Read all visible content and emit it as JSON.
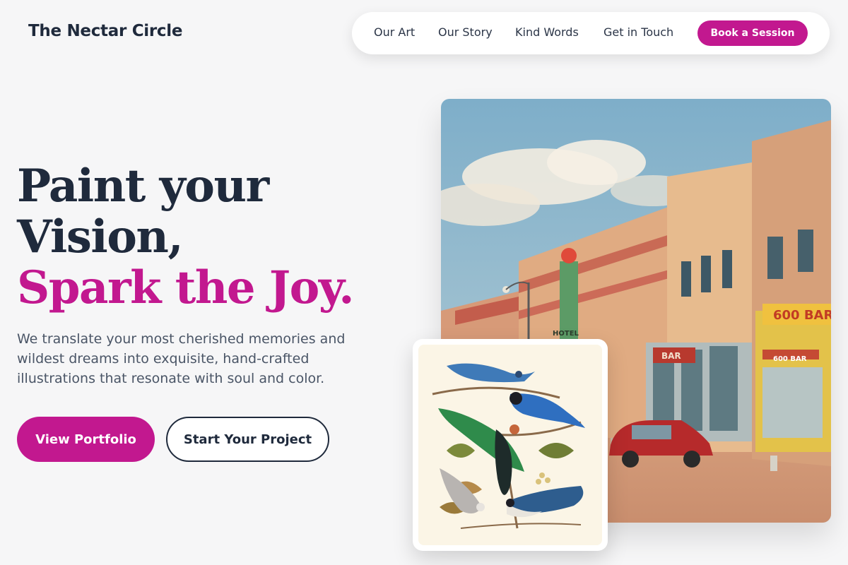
{
  "brand": {
    "name": "The Nectar Circle"
  },
  "nav": {
    "links": [
      "Our Art",
      "Our Story",
      "Kind Words",
      "Get in Touch"
    ],
    "cta_label": "Book a Session"
  },
  "hero": {
    "headline_line1": "Paint your",
    "headline_line2": "Vision,",
    "headline_accent": "Spark the Joy.",
    "lead": "We translate your most cherished memories and wildest dreams into exquisite, hand-crafted illustrations that resonate with soul and color.",
    "primary_button": "View Portfolio",
    "secondary_button": "Start Your Project"
  },
  "images": {
    "street_signs": {
      "hotel": "HOTEL",
      "bar": "BAR",
      "bar_600": "600 BAR",
      "bar_600_small": "600 BAR"
    }
  },
  "colors": {
    "accent": "#c2188f",
    "ink": "#1f2a3c",
    "background": "#f6f6f7"
  }
}
